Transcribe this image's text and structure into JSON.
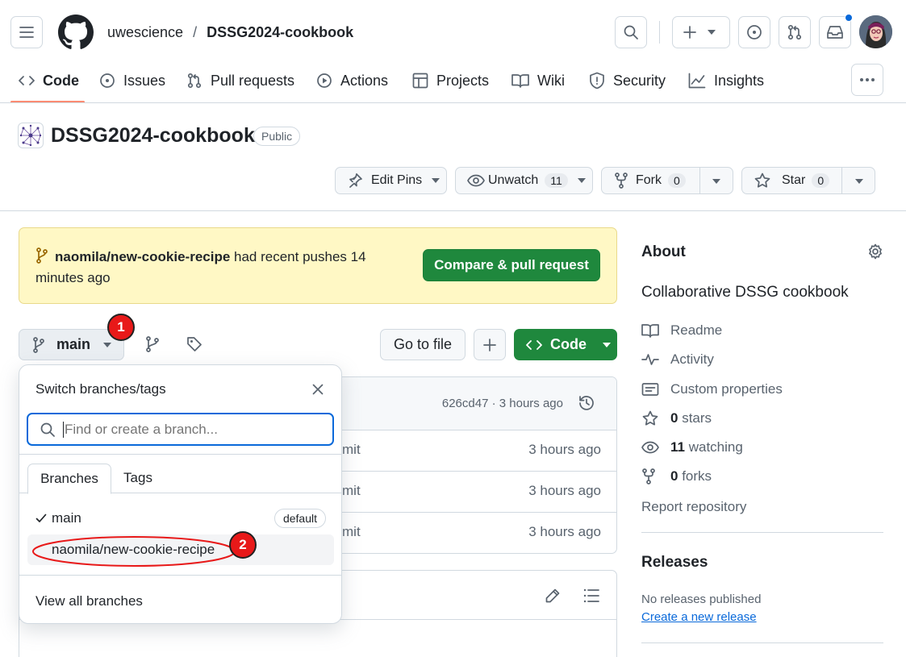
{
  "header": {
    "owner": "uwescience",
    "separator": "/",
    "repo": "DSSG2024-cookbook"
  },
  "tabs": [
    {
      "label": "Code",
      "icon": "code-icon"
    },
    {
      "label": "Issues",
      "icon": "issue-icon"
    },
    {
      "label": "Pull requests",
      "icon": "pull-request-icon"
    },
    {
      "label": "Actions",
      "icon": "play-icon"
    },
    {
      "label": "Projects",
      "icon": "table-icon"
    },
    {
      "label": "Wiki",
      "icon": "book-icon"
    },
    {
      "label": "Security",
      "icon": "shield-icon"
    },
    {
      "label": "Insights",
      "icon": "graph-icon"
    }
  ],
  "repo_header": {
    "title": "DSSG2024-cookbook",
    "visibility": "Public",
    "edit_pins": "Edit Pins",
    "unwatch": "Unwatch",
    "watch_count": "11",
    "fork": "Fork",
    "fork_count": "0",
    "star": "Star",
    "star_count": "0"
  },
  "banner": {
    "branch": "naomila/new-cookie-recipe",
    "text_after": " had recent pushes 14 minutes ago",
    "button": "Compare & pull request"
  },
  "toolbar": {
    "branch": "main",
    "go_to_file": "Go to file",
    "code": "Code"
  },
  "latest_commit": {
    "hash_time": "626cd47 · 3 hours ago"
  },
  "commit_rows": [
    {
      "msg": "mit",
      "time": "3 hours ago"
    },
    {
      "msg": "mit",
      "time": "3 hours ago"
    },
    {
      "msg": "mit",
      "time": "3 hours ago"
    }
  ],
  "dropdown": {
    "title": "Switch branches/tags",
    "search_placeholder": "Find or create a branch...",
    "tab_branches": "Branches",
    "tab_tags": "Tags",
    "items": [
      {
        "name": "main",
        "badge": "default",
        "checked": true
      },
      {
        "name": "naomila/new-cookie-recipe",
        "badge": "",
        "checked": false
      }
    ],
    "view_all": "View all branches"
  },
  "annotations": {
    "marker1": "1",
    "marker2": "2",
    "marker_color": "#e81919"
  },
  "about": {
    "heading": "About",
    "description": "Collaborative DSSG cookbook",
    "readme": "Readme",
    "activity": "Activity",
    "custom_properties": "Custom properties",
    "stars_count": "0",
    "stars_label": " stars",
    "watching_count": "11",
    "watching_label": " watching",
    "forks_count": "0",
    "forks_label": " forks",
    "report": "Report repository"
  },
  "releases": {
    "heading": "Releases",
    "none": "No releases published",
    "create": "Create a new release"
  },
  "colors": {
    "accent_green": "#1f883d",
    "banner_bg": "#fff8c5",
    "link_blue": "#0969da",
    "active_tab_underline": "#fd8c73"
  }
}
